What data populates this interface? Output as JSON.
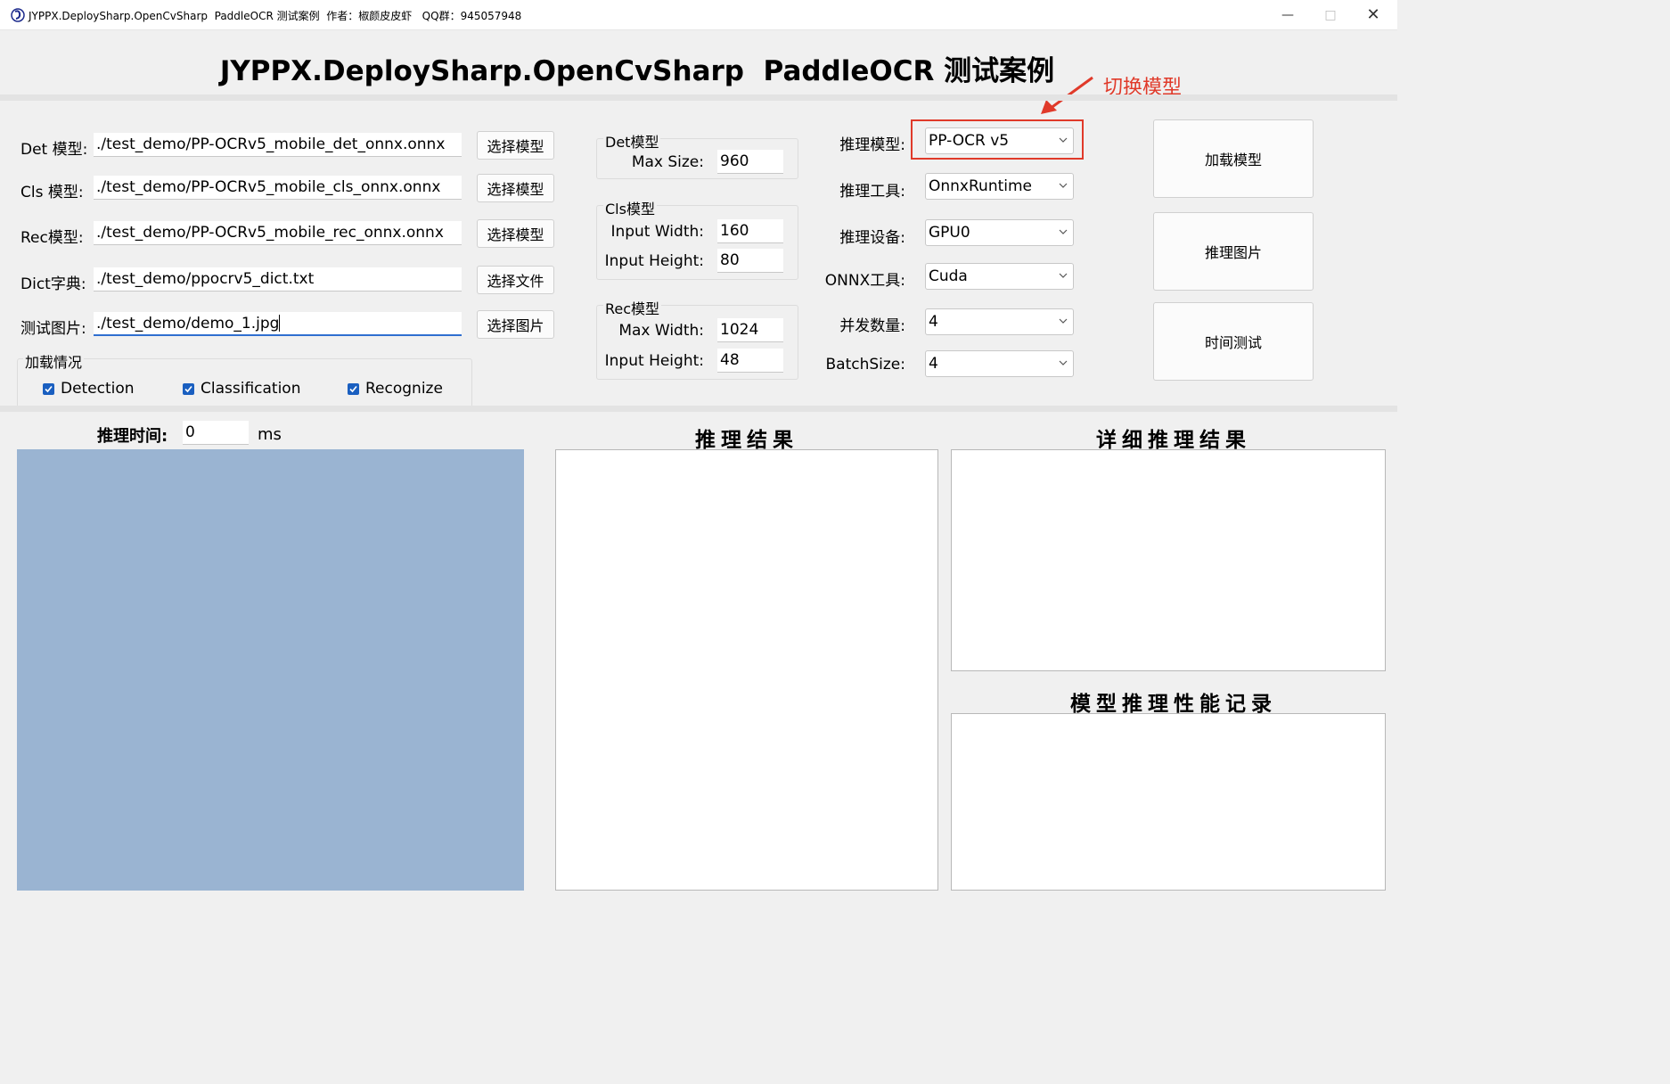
{
  "window": {
    "title": "JYPPX.DeploySharp.OpenCvSharp  PaddleOCR 测试案例  作者：椒颜皮皮虾   QQ群：945057948"
  },
  "heading": "JYPPX.DeploySharp.OpenCvSharp  PaddleOCR 测试案例",
  "annotation": {
    "text": "切换模型",
    "color": "#e03a2a"
  },
  "files": [
    {
      "label": "Det 模型:",
      "value": "./test_demo/PP-OCRv5_mobile_det_onnx.onnx",
      "button": "选择模型"
    },
    {
      "label": "Cls 模型:",
      "value": "./test_demo/PP-OCRv5_mobile_cls_onnx.onnx",
      "button": "选择模型"
    },
    {
      "label": "Rec模型:",
      "value": "./test_demo/PP-OCRv5_mobile_rec_onnx.onnx",
      "button": "选择模型"
    },
    {
      "label": "Dict字典:",
      "value": "./test_demo/ppocrv5_dict.txt",
      "button": "选择文件"
    },
    {
      "label": "测试图片:",
      "value": "./test_demo/demo_1.jpg",
      "button": "选择图片"
    }
  ],
  "load_status": {
    "title": "加载情况",
    "items": [
      {
        "label": "Detection",
        "checked": true
      },
      {
        "label": "Classification",
        "checked": true
      },
      {
        "label": "Recognize",
        "checked": true
      }
    ]
  },
  "det_group": {
    "title": "Det模型",
    "max_size_label": "Max Size:",
    "max_size": "960"
  },
  "cls_group": {
    "title": "Cls模型",
    "width_label": "Input Width:",
    "width": "160",
    "height_label": "Input Height:",
    "height": "80"
  },
  "rec_group": {
    "title": "Rec模型",
    "max_width_label": "Max Width:",
    "max_width": "1024",
    "height_label": "Input Height:",
    "height": "48"
  },
  "settings": [
    {
      "label": "推理模型:",
      "value": "PP-OCR v5"
    },
    {
      "label": "推理工具:",
      "value": "OnnxRuntime"
    },
    {
      "label": "推理设备:",
      "value": "GPU0"
    },
    {
      "label": "ONNX工具:",
      "value": "Cuda"
    },
    {
      "label": "并发数量:",
      "value": "4"
    },
    {
      "label": "BatchSize:",
      "value": "4"
    }
  ],
  "actions": {
    "load": "加载模型",
    "infer": "推理图片",
    "timing": "时间测试"
  },
  "timing": {
    "label": "推理时间:",
    "value": "0",
    "unit": "ms"
  },
  "panels": {
    "result": "推理结果",
    "detail": "详细推理结果",
    "perf": "模型推理性能记录"
  },
  "colors": {
    "image_area": "#9ab4d2",
    "accent": "#e03a2a",
    "check": "#1a5fc0"
  }
}
